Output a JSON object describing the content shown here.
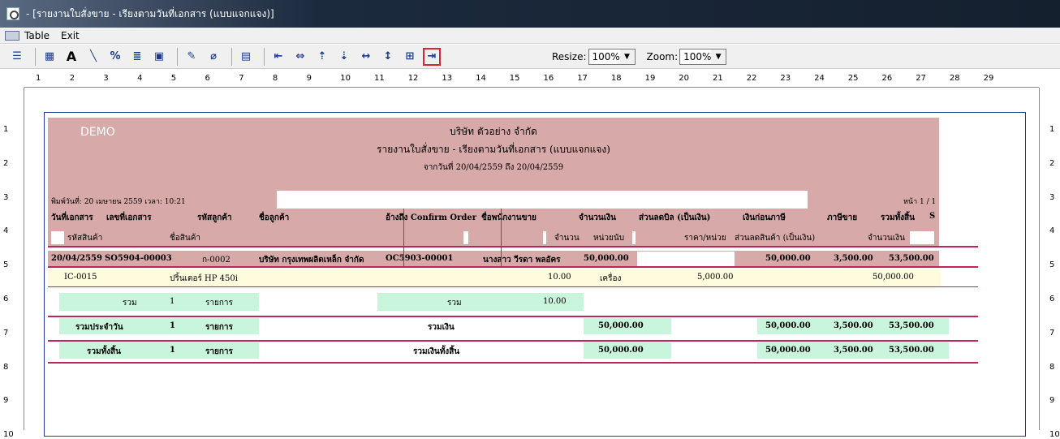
{
  "window": {
    "title": "- [รายงานใบสั่งขาย - เรียงตามวันที่เอกสาร (แบบแจกแจง)]"
  },
  "menu": {
    "items": [
      "Table",
      "Exit"
    ]
  },
  "toolbar": {
    "resize_label": "Resize:",
    "resize_value": "100%",
    "zoom_label": "Zoom:",
    "zoom_value": "100%"
  },
  "ruler": {
    "top": [
      "1",
      "2",
      "3",
      "4",
      "5",
      "6",
      "7",
      "8",
      "9",
      "10",
      "11",
      "12",
      "13",
      "14",
      "15",
      "16",
      "17",
      "18",
      "19",
      "20",
      "21",
      "22",
      "23",
      "24",
      "25",
      "26",
      "27",
      "28",
      "29"
    ],
    "side": [
      "1",
      "2",
      "3",
      "4",
      "5",
      "6",
      "7",
      "8",
      "9",
      "10"
    ]
  },
  "report": {
    "demo": "DEMO",
    "company": "บริษัท ตัวอย่าง จำกัด",
    "title": "รายงานใบสั่งขาย - เรียงตามวันที่เอกสาร (แบบแจกแจง)",
    "range": "จากวันที่ 20/04/2559 ถึง 20/04/2559",
    "printed": "พิมพ์วันที่: 20 เมษายน 2559 เวลา: 10:21",
    "page": "หน้า 1 / 1",
    "header1": [
      "วันที่เอกสาร",
      "เลขที่เอกสาร",
      "รหัสลูกค้า",
      "ชื่อลูกค้า",
      "อ้างถึง Confirm Order",
      "ชื่อพนักงานขาย",
      "จำนวนเงิน",
      "ส่วนลดบิล (เป็นเงิน)",
      "เงินก่อนภาษี",
      "ภาษีขาย",
      "รวมทั้งสิ้น",
      "S"
    ],
    "header2": [
      "รหัสสินค้า",
      "ชื่อสินค้า",
      "จำนวน",
      "หน่วยนับ",
      "ราคา/หน่วย",
      "ส่วนลดสินค้า (เป็นเงิน)",
      "จำนวนเงิน"
    ],
    "doc": [
      "20/04/2559",
      "SO5904-00003",
      "ก-0002",
      "บริษัท กรุงเทพผลิตเหล็ก จำกัด",
      "OC5903-00001",
      "นางสาว วีรดา พลอัคร",
      "50,000.00",
      "50,000.00",
      "3,500.00",
      "53,500.00"
    ],
    "item": [
      "IC-0015",
      "ปริ้นเตอร์ HP 450i",
      "10.00",
      "เครื่อง",
      "5,000.00",
      "50,000.00"
    ],
    "sum1": [
      "รวม",
      "1",
      "รายการ",
      "รวม",
      "10.00"
    ],
    "sum2": [
      "รวมประจำวัน",
      "1",
      "รายการ",
      "รวมเงิน",
      "50,000.00",
      "50,000.00",
      "3,500.00",
      "53,500.00"
    ],
    "sum3": [
      "รวมทั้งสิ้น",
      "1",
      "รายการ",
      "รวมเงินทั้งสิ้น",
      "50,000.00",
      "50,000.00",
      "3,500.00",
      "53,500.00"
    ]
  }
}
